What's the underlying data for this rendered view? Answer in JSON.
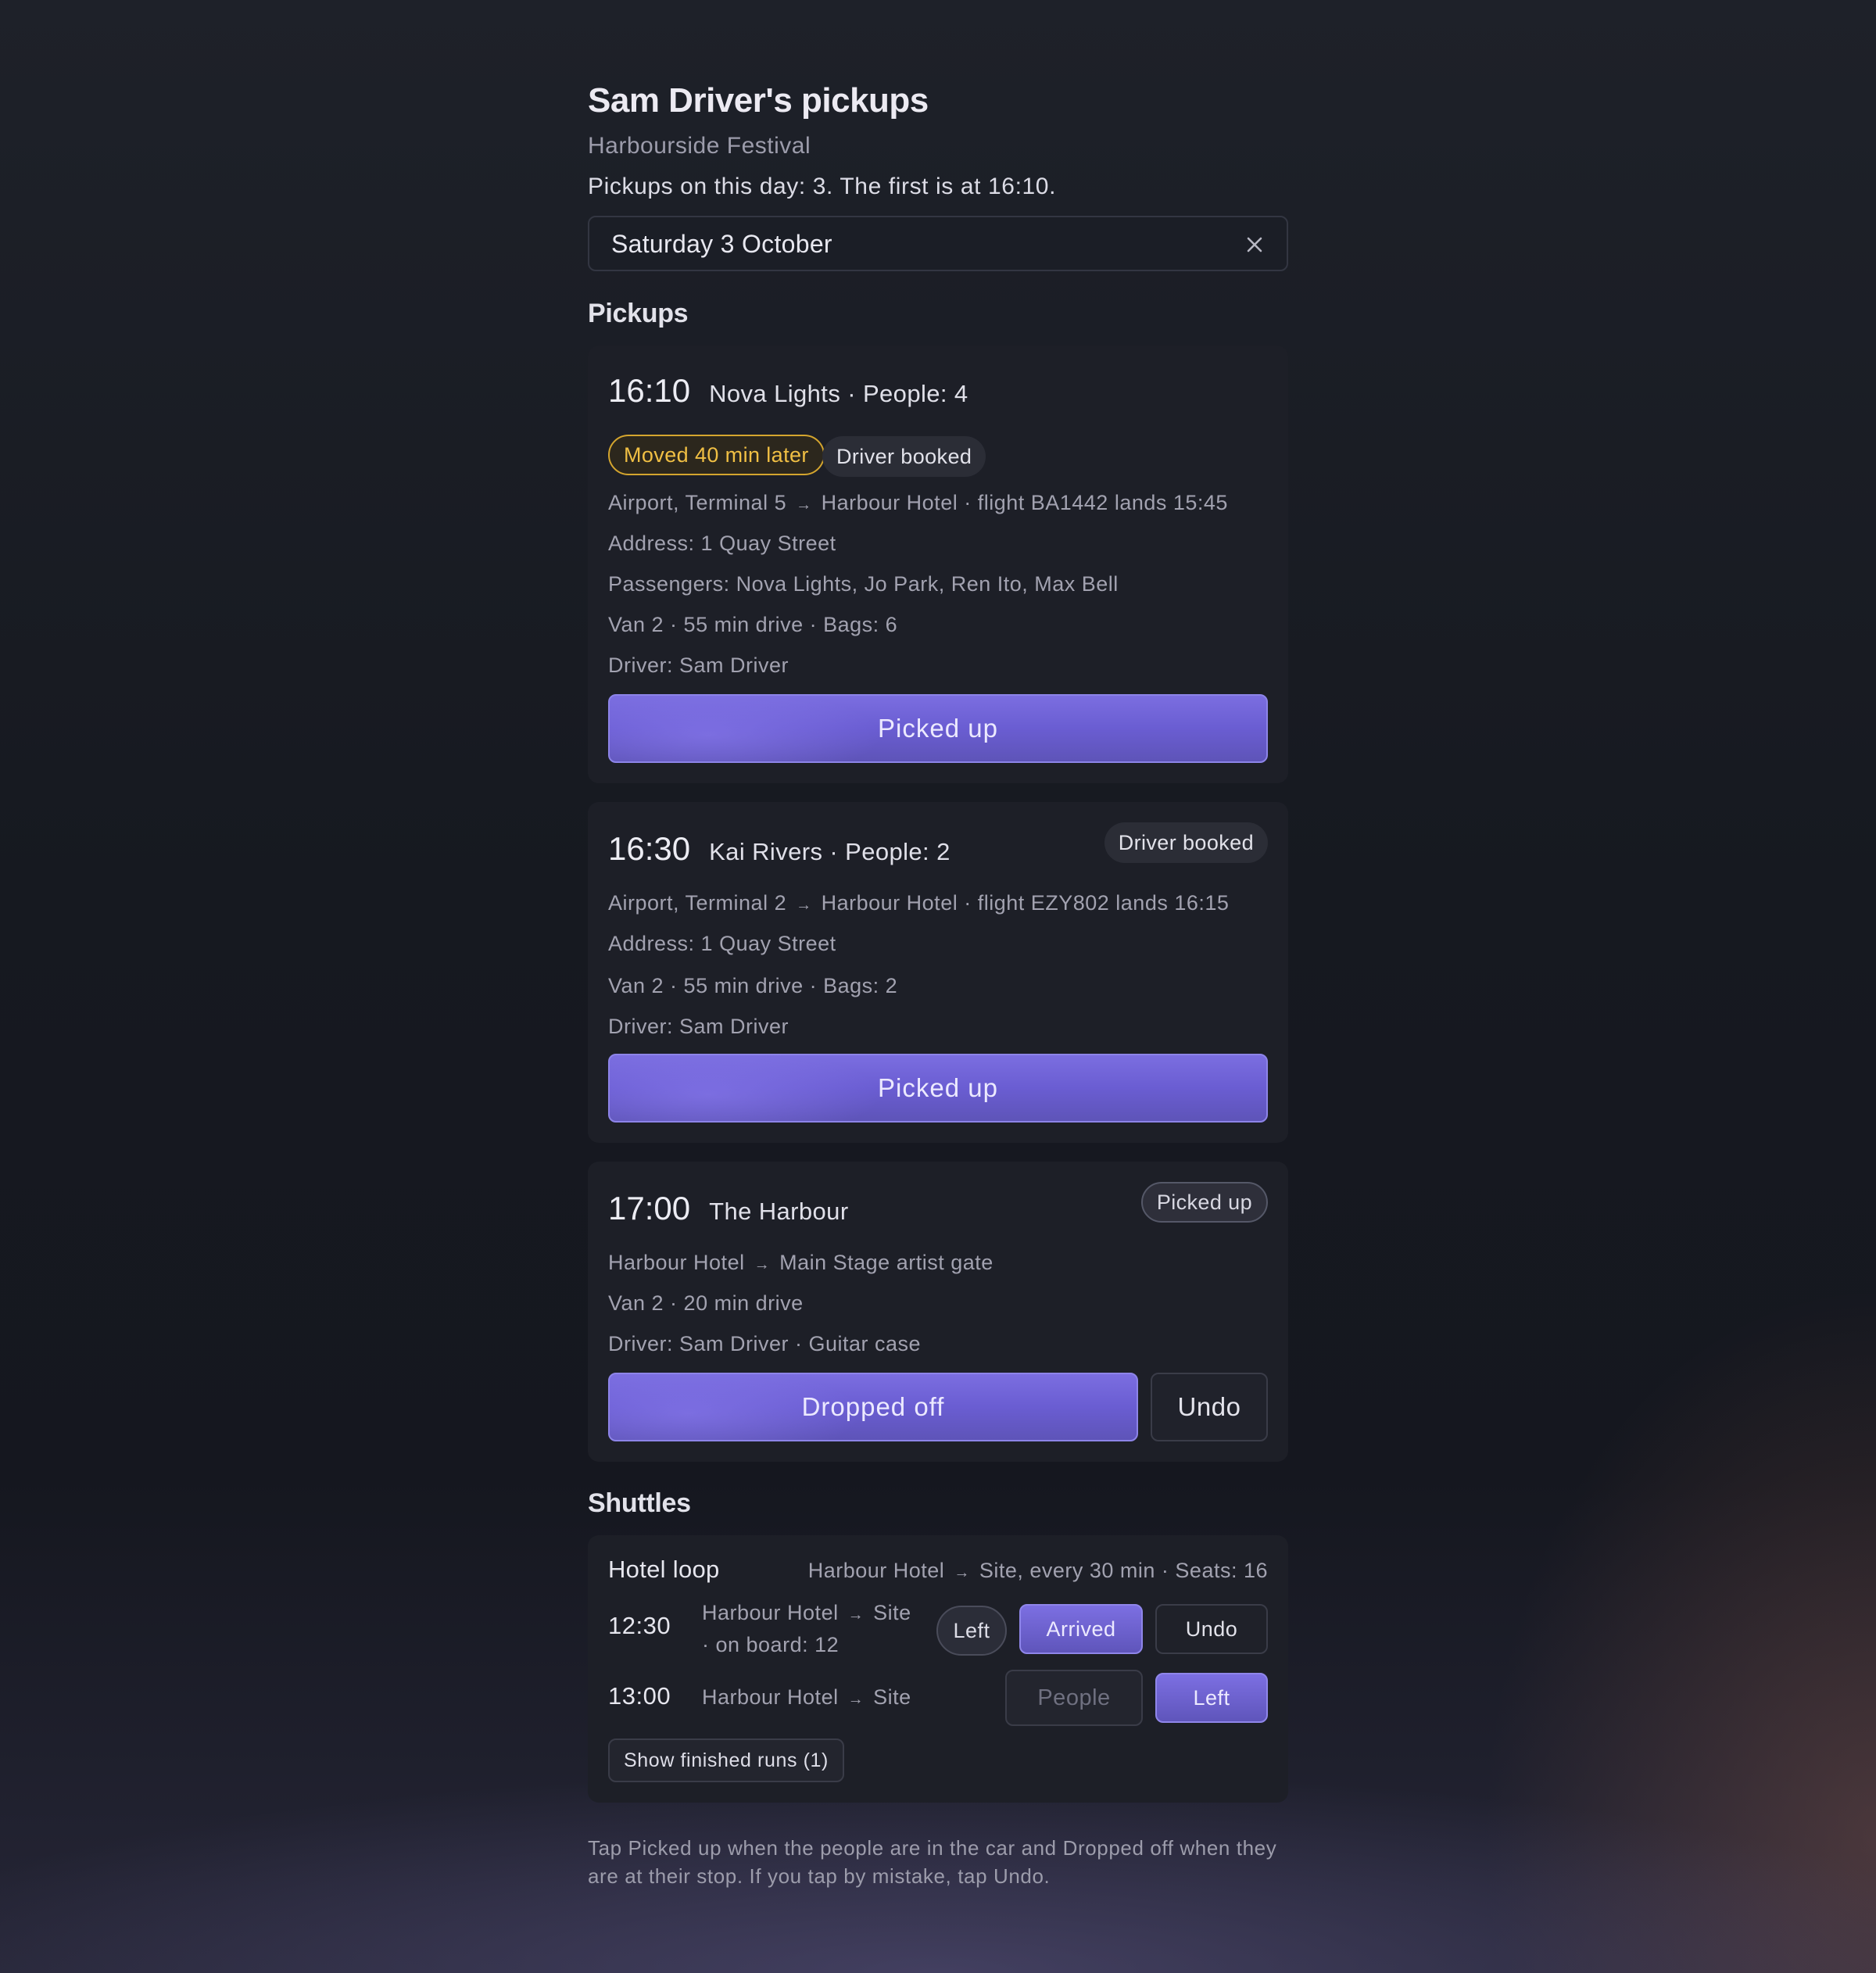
{
  "header": {
    "title": "Sam Driver's pickups",
    "subtitle": "Harbourside Festival",
    "summary": "Pickups on this day: 3. The first is at 16:10."
  },
  "date_picker": {
    "value": "Saturday 3 October",
    "clear_icon": "close-icon"
  },
  "sections": {
    "pickups": "Pickups",
    "shuttles": "Shuttles"
  },
  "pickups": [
    {
      "time": "16:10",
      "who": "Nova Lights · People: 4",
      "badges": [
        "Moved 40 min later",
        "Driver booked"
      ],
      "route_from": "Airport, Terminal 5",
      "route_to": "Harbour Hotel · flight BA1442 lands 15:45",
      "address": "Address: 1 Quay Street",
      "passengers": "Passengers: Nova Lights, Jo Park, Ren Ito, Max Bell",
      "vehicle": "Van 2 · 55 min drive · Bags: 6",
      "driver": "Driver: Sam Driver",
      "action": "Picked up"
    },
    {
      "time": "16:30",
      "who": "Kai Rivers · People: 2",
      "badge": "Driver booked",
      "route_from": "Airport, Terminal 2",
      "route_to": "Harbour Hotel · flight EZY802 lands 16:15",
      "address": "Address: 1 Quay Street",
      "vehicle": "Van 2 · 55 min drive · Bags: 2",
      "driver": "Driver: Sam Driver",
      "action": "Picked up"
    },
    {
      "time": "17:00",
      "who": "The Harbour",
      "badge": "Picked up",
      "route_from": "Harbour Hotel",
      "route_to": "Main Stage artist gate",
      "vehicle": "Van 2 · 20 min drive",
      "driver": "Driver: Sam Driver · Guitar case",
      "action": "Dropped off",
      "undo": "Undo"
    }
  ],
  "arrow_glyph": "→",
  "shuttle": {
    "name": "Hotel loop",
    "route_from": "Harbour Hotel",
    "route_to": "Site, every 30 min · Seats: 16",
    "runs": [
      {
        "time": "12:30",
        "route_from": "Harbour Hotel",
        "route_to": "Site",
        "onboard": "· on board: 12",
        "left_label": "Left",
        "arrived_label": "Arrived",
        "undo_label": "Undo"
      },
      {
        "time": "13:00",
        "route_from": "Harbour Hotel",
        "route_to": "Site",
        "people_placeholder": "People",
        "left_label": "Left"
      }
    ],
    "show_finished": "Show finished runs (1)"
  },
  "footnote": "Tap Picked up when the people are in the car and Dropped off when they are at their stop. If you tap by mistake, tap Undo.",
  "colors": {
    "accent": "#6c60d4",
    "warning": "#f0bf44",
    "background": "#181a21"
  }
}
